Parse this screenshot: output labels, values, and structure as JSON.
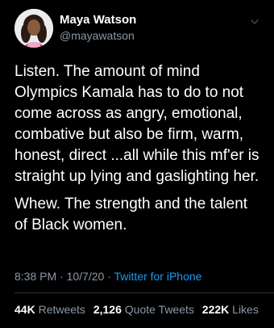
{
  "author": {
    "name": "Maya Watson",
    "handle": "@mayawatson",
    "avatar_icon": "profile-photo"
  },
  "tweet": {
    "paragraphs": [
      "Listen. The amount of mind\nOlympics Kamala has to do to not\ncome across as angry, emotional,\ncombative but also be firm, warm,\nhonest, direct ...all while this mf'er is\nstraight up lying and gaslighting her.",
      "Whew. The strength and the talent\nof Black women."
    ]
  },
  "meta": {
    "time": "8:38 PM",
    "separator1": " · ",
    "date": "10/7/20",
    "separator2": " · ",
    "source": "Twitter for iPhone"
  },
  "stats": {
    "retweets_count": "44K",
    "retweets_label": "Retweets",
    "quotes_count": "2,126",
    "quotes_label": "Quote Tweets",
    "likes_count": "222K",
    "likes_label": "Likes"
  },
  "colors": {
    "background": "#000000",
    "text": "#ffffff",
    "secondary": "#8b98a5",
    "link": "#1d9bf0",
    "divider": "#2f3336"
  }
}
